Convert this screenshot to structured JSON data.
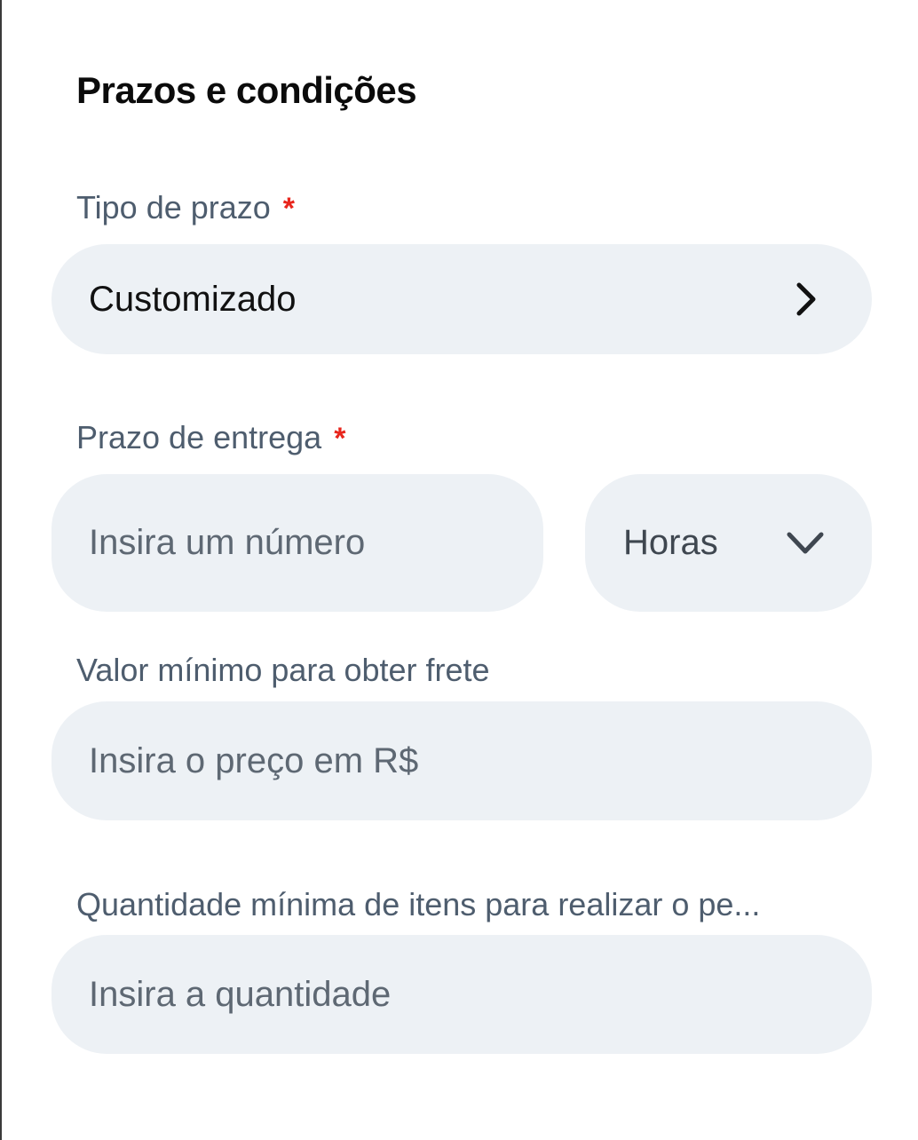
{
  "section": {
    "title": "Prazos e condições"
  },
  "deadline_type": {
    "label": "Tipo de prazo",
    "required_mark": "*",
    "value": "Customizado",
    "icon": "chevron-right-icon"
  },
  "delivery_time": {
    "label": "Prazo de entrega",
    "required_mark": "*",
    "placeholder": "Insira um número",
    "unit_value": "Horas",
    "unit_icon": "chevron-down-icon"
  },
  "min_shipping_value": {
    "label": "Valor mínimo para obter frete",
    "placeholder": "Insira o preço em R$"
  },
  "min_items": {
    "label": "Quantidade mínima de itens para realizar o pe...",
    "placeholder": "Insira a quantidade"
  },
  "colors": {
    "field_background": "#edf1f5",
    "label": "#4e5d6e",
    "required": "#e8261d",
    "title": "#0b0b0b"
  }
}
